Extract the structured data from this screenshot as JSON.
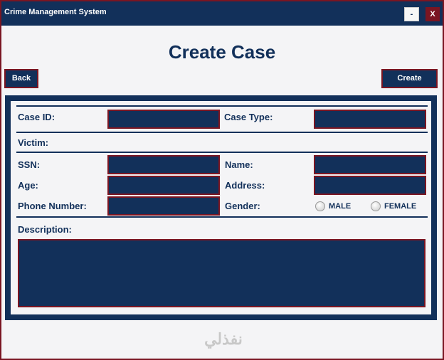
{
  "window": {
    "title": "Crime Management System",
    "minimize_label": "-",
    "close_label": "X"
  },
  "page": {
    "title": "Create Case"
  },
  "toolbar": {
    "back_label": "Back",
    "create_label": "Create"
  },
  "form": {
    "case_id_label": "Case ID:",
    "case_type_label": "Case Type:",
    "victim_label": "Victim:",
    "ssn_label": "SSN:",
    "name_label": "Name:",
    "age_label": "Age:",
    "address_label": "Address:",
    "phone_label": "Phone Number:",
    "gender_label": "Gender:",
    "gender_options": [
      "MALE",
      "FEMALE"
    ],
    "description_label": "Description:"
  },
  "watermark": {
    "text": "نفذلي"
  },
  "colors": {
    "navy": "#12305a",
    "maroon": "#7a1522",
    "background": "#f4f4f6"
  }
}
